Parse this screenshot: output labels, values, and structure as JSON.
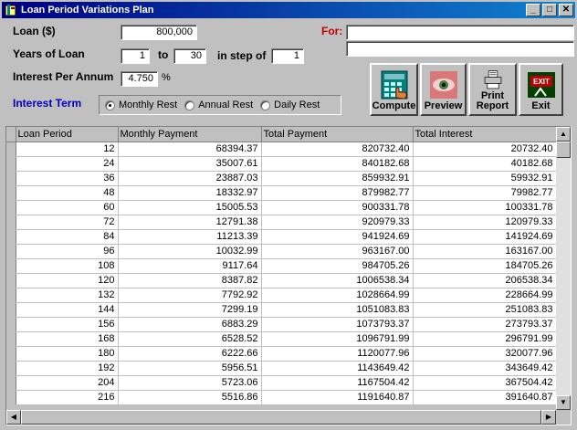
{
  "window": {
    "title": "Loan Period Variations Plan",
    "minimize": "_",
    "maximize": "□",
    "close": "✕"
  },
  "form": {
    "loan_label": "Loan ($)",
    "loan_value": "800,000",
    "years_label": "Years of Loan",
    "years_from": "1",
    "to_label": "to",
    "years_to": "30",
    "step_label": "in step of",
    "step_value": "1",
    "interest_label": "Interest Per Annum",
    "interest_value": "4.750",
    "percent_sign": "%",
    "for_label": "For:",
    "for_value_1": "",
    "for_value_2": "",
    "term_label": "Interest Term",
    "term_options": [
      "Monthly Rest",
      "Annual Rest",
      "Daily Rest"
    ],
    "term_selected": "Monthly Rest"
  },
  "buttons": {
    "compute": "Compute",
    "preview": "Preview",
    "print_1": "Print",
    "print_2": "Report",
    "exit": "Exit",
    "exit_icon_text": "EXIT"
  },
  "table": {
    "columns": [
      "Loan Period",
      "Monthly Payment",
      "Total Payment",
      "Total Interest"
    ],
    "rows": [
      [
        "12",
        "68394.37",
        "820732.40",
        "20732.40"
      ],
      [
        "24",
        "35007.61",
        "840182.68",
        "40182.68"
      ],
      [
        "36",
        "23887.03",
        "859932.91",
        "59932.91"
      ],
      [
        "48",
        "18332.97",
        "879982.77",
        "79982.77"
      ],
      [
        "60",
        "15005.53",
        "900331.78",
        "100331.78"
      ],
      [
        "72",
        "12791.38",
        "920979.33",
        "120979.33"
      ],
      [
        "84",
        "11213.39",
        "941924.69",
        "141924.69"
      ],
      [
        "96",
        "10032.99",
        "963167.00",
        "163167.00"
      ],
      [
        "108",
        "9117.64",
        "984705.26",
        "184705.26"
      ],
      [
        "120",
        "8387.82",
        "1006538.34",
        "206538.34"
      ],
      [
        "132",
        "7792.92",
        "1028664.99",
        "228664.99"
      ],
      [
        "144",
        "7299.19",
        "1051083.83",
        "251083.83"
      ],
      [
        "156",
        "6883.29",
        "1073793.37",
        "273793.37"
      ],
      [
        "168",
        "6528.52",
        "1096791.99",
        "296791.99"
      ],
      [
        "180",
        "6222.66",
        "1120077.96",
        "320077.96"
      ],
      [
        "192",
        "5956.51",
        "1143649.42",
        "343649.42"
      ],
      [
        "204",
        "5723.06",
        "1167504.42",
        "367504.42"
      ],
      [
        "216",
        "5516.86",
        "1191640.87",
        "391640.87"
      ]
    ]
  },
  "colors": {
    "title_bar": "#000080",
    "for_label": "#c00000",
    "term_label": "#0000c0"
  }
}
